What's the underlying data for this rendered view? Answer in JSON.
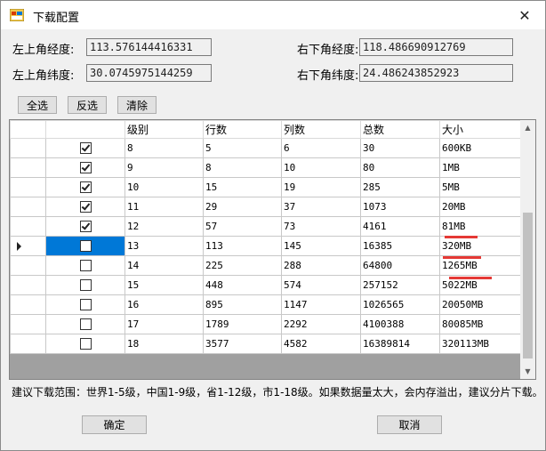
{
  "window": {
    "title": "下载配置"
  },
  "coords": {
    "top_left_lon_label": "左上角经度:",
    "top_left_lon_value": "113.576144416331",
    "bottom_right_lon_label": "右下角经度:",
    "bottom_right_lon_value": "118.486690912769",
    "top_left_lat_label": "左上角纬度:",
    "top_left_lat_value": "30.0745975144259",
    "bottom_right_lat_label": "右下角纬度:",
    "bottom_right_lat_value": "24.486243852923"
  },
  "toolbar": {
    "select_all": "全选",
    "invert": "反选",
    "clear": "清除"
  },
  "table": {
    "headers": [
      "级别",
      "行数",
      "列数",
      "总数",
      "大小"
    ],
    "rows": [
      {
        "checked": true,
        "cells": [
          "8",
          "5",
          "6",
          "30",
          "600KB"
        ]
      },
      {
        "checked": true,
        "cells": [
          "9",
          "8",
          "10",
          "80",
          "1MB"
        ]
      },
      {
        "checked": true,
        "cells": [
          "10",
          "15",
          "19",
          "285",
          "5MB"
        ]
      },
      {
        "checked": true,
        "cells": [
          "11",
          "29",
          "37",
          "1073",
          "20MB"
        ]
      },
      {
        "checked": true,
        "cells": [
          "12",
          "57",
          "73",
          "4161",
          "81MB"
        ]
      },
      {
        "checked": false,
        "cells": [
          "13",
          "113",
          "145",
          "16385",
          "320MB"
        ],
        "current": true
      },
      {
        "checked": false,
        "cells": [
          "14",
          "225",
          "288",
          "64800",
          "1265MB"
        ]
      },
      {
        "checked": false,
        "cells": [
          "15",
          "448",
          "574",
          "257152",
          "5022MB"
        ]
      },
      {
        "checked": false,
        "cells": [
          "16",
          "895",
          "1147",
          "1026565",
          "20050MB"
        ]
      },
      {
        "checked": false,
        "cells": [
          "17",
          "1789",
          "2292",
          "4100388",
          "80085MB"
        ]
      },
      {
        "checked": false,
        "cells": [
          "18",
          "3577",
          "4582",
          "16389814",
          "320113MB"
        ]
      }
    ]
  },
  "hint": "建议下载范围：世界1-5级，中国1-9级，省1-12级，市1-18级。如果数据量太大，会内存溢出，建议分片下载。",
  "buttons": {
    "ok": "确定",
    "cancel": "取消"
  },
  "colors": {
    "selection": "#0078d7",
    "annotation": "#e53935"
  }
}
